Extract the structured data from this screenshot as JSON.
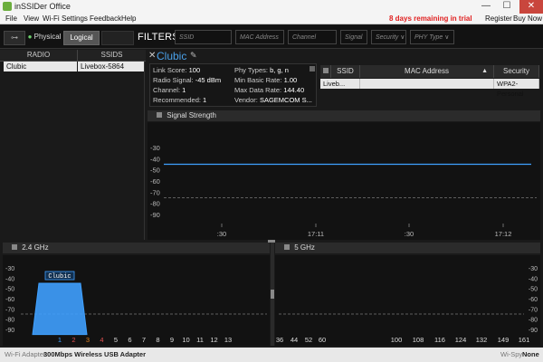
{
  "window": {
    "title": "inSSIDer Office",
    "minimize": "—",
    "maximize": "☐",
    "close": "✕"
  },
  "menu": {
    "file": "File",
    "view": "View",
    "wifi": "Wi-Fi",
    "settings": "Settings",
    "feedback": "Feedback",
    "help": "Help",
    "trial": "8 days remaining in trial",
    "register": "Register",
    "buy": "Buy Now"
  },
  "toolbar": {
    "physical": "Physical",
    "logical": "Logical",
    "filters_label": "FILTERS:"
  },
  "filters": [
    {
      "label": "SSID",
      "dropdown": false
    },
    {
      "label": "MAC Address",
      "dropdown": false
    },
    {
      "label": "Channel",
      "dropdown": false
    },
    {
      "label": "Signal",
      "dropdown": false
    },
    {
      "label": "Security ∨",
      "dropdown": true
    },
    {
      "label": "PHY Type ∨",
      "dropdown": true
    }
  ],
  "radio_table": {
    "headers": {
      "radio": "RADIO",
      "ssids": "SSIDS"
    },
    "rows": [
      {
        "radio": "Clubic",
        "ssids": "Livebox-5864"
      }
    ]
  },
  "detail": {
    "close": "✕",
    "title": "Clubic",
    "edit_icon": "pencil-icon",
    "left": [
      {
        "label": "Link Score:",
        "value": "100"
      },
      {
        "label": "Radio Signal:",
        "value": "-45 dBm"
      },
      {
        "label": "Channel:",
        "value": "1"
      },
      {
        "label": "Recommended:",
        "value": "1"
      }
    ],
    "right": [
      {
        "label": "Phy Types:",
        "value": "b, g, n"
      },
      {
        "label": "Min Basic Rate:",
        "value": "1.00"
      },
      {
        "label": "Max Data Rate:",
        "value": "144.40"
      },
      {
        "label": "Vendor:",
        "value": "SAGEMCOM S..."
      }
    ]
  },
  "net_table": {
    "headers": {
      "ssid": "SSID",
      "mac": "MAC Address",
      "sort": "▲",
      "security": "Security"
    },
    "rows": [
      {
        "ssid": "Liveb...",
        "mac": "",
        "security": "WPA2-Personal"
      }
    ]
  },
  "signal_panel": {
    "title": "Signal Strength",
    "y_labels": [
      "-30",
      "-40",
      "-50",
      "-60",
      "-70",
      "-80",
      "-90"
    ],
    "x_labels": [
      ":30",
      "17:11",
      ":30",
      "17:12"
    ]
  },
  "band24": {
    "title": "2.4 GHz",
    "network_label": "Clubic",
    "y_labels": [
      "-30",
      "-40",
      "-50",
      "-60",
      "-70",
      "-80",
      "-90"
    ],
    "channels": [
      "1",
      "2",
      "3",
      "4",
      "5",
      "6",
      "7",
      "8",
      "9",
      "10",
      "11",
      "12",
      "13"
    ],
    "channel_colors": [
      "#3fa0ff",
      "#e05050",
      "#e08020",
      "#e05050",
      "#ddd",
      "#ddd",
      "#ddd",
      "#ddd",
      "#ddd",
      "#ddd",
      "#ddd",
      "#ddd",
      "#ddd"
    ]
  },
  "band5": {
    "title": "5 GHz",
    "y_labels": [
      "-30",
      "-40",
      "-50",
      "-60",
      "-70",
      "-80",
      "-90"
    ],
    "channels": [
      "36",
      "44",
      "52",
      "60",
      "100",
      "108",
      "116",
      "124",
      "132",
      "149",
      "161"
    ]
  },
  "status": {
    "adapter_label": "Wi-Fi Adapter:",
    "adapter_value": "300Mbps Wireless USB Adapter",
    "wispy_label": "Wi-Spy:",
    "wispy_value": "None"
  },
  "chart_data": [
    {
      "type": "line",
      "title": "Signal Strength",
      "xlabel": "",
      "ylabel": "",
      "x": [
        ":30",
        "17:11",
        ":30",
        "17:12"
      ],
      "ylim": [
        -95,
        -25
      ],
      "series": [
        {
          "values": [
            -45,
            -45,
            -45,
            -45
          ],
          "color": "#3fa0ff"
        }
      ],
      "reference_line": -75,
      "grid": false
    },
    {
      "type": "area",
      "title": "2.4 GHz",
      "ylim": [
        -95,
        -25
      ],
      "series": [
        {
          "name": "Clubic",
          "channel": 1,
          "signal": -45,
          "color": "#3fa0ff"
        }
      ],
      "reference_line": -75
    },
    {
      "type": "area",
      "title": "5 GHz",
      "ylim": [
        -95,
        -25
      ],
      "series": [],
      "reference_line": -75
    }
  ]
}
